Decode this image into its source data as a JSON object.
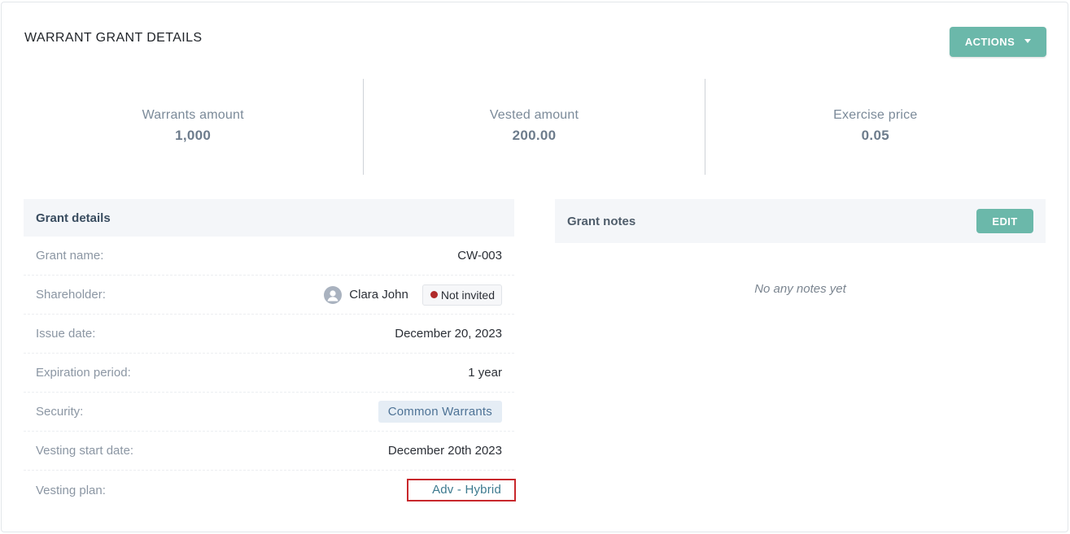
{
  "header": {
    "title": "WARRANT GRANT DETAILS",
    "actions_label": "ACTIONS"
  },
  "stats": [
    {
      "label": "Warrants amount",
      "value": "1,000"
    },
    {
      "label": "Vested amount",
      "value": "200.00"
    },
    {
      "label": "Exercise price",
      "value": "0.05"
    }
  ],
  "grant_details": {
    "title": "Grant details",
    "grant_name": {
      "label": "Grant name:",
      "value": "CW-003"
    },
    "shareholder": {
      "label": "Shareholder:",
      "name": "Clara John",
      "status": "Not invited"
    },
    "issue_date": {
      "label": "Issue date:",
      "value": "December 20, 2023"
    },
    "expiration_period": {
      "label": "Expiration period:",
      "value": "1 year"
    },
    "security": {
      "label": "Security:",
      "value": "Common Warrants"
    },
    "vesting_start_date": {
      "label": "Vesting start date:",
      "value": "December 20th 2023"
    },
    "vesting_plan": {
      "label": "Vesting plan:",
      "value": "Adv - Hybrid"
    }
  },
  "grant_notes": {
    "title": "Grant notes",
    "edit_label": "EDIT",
    "empty_text": "No any notes yet"
  },
  "colors": {
    "accent": "#6bb8aa",
    "status_not_invited": "#b02a2a",
    "highlight_border": "#c8282c"
  }
}
